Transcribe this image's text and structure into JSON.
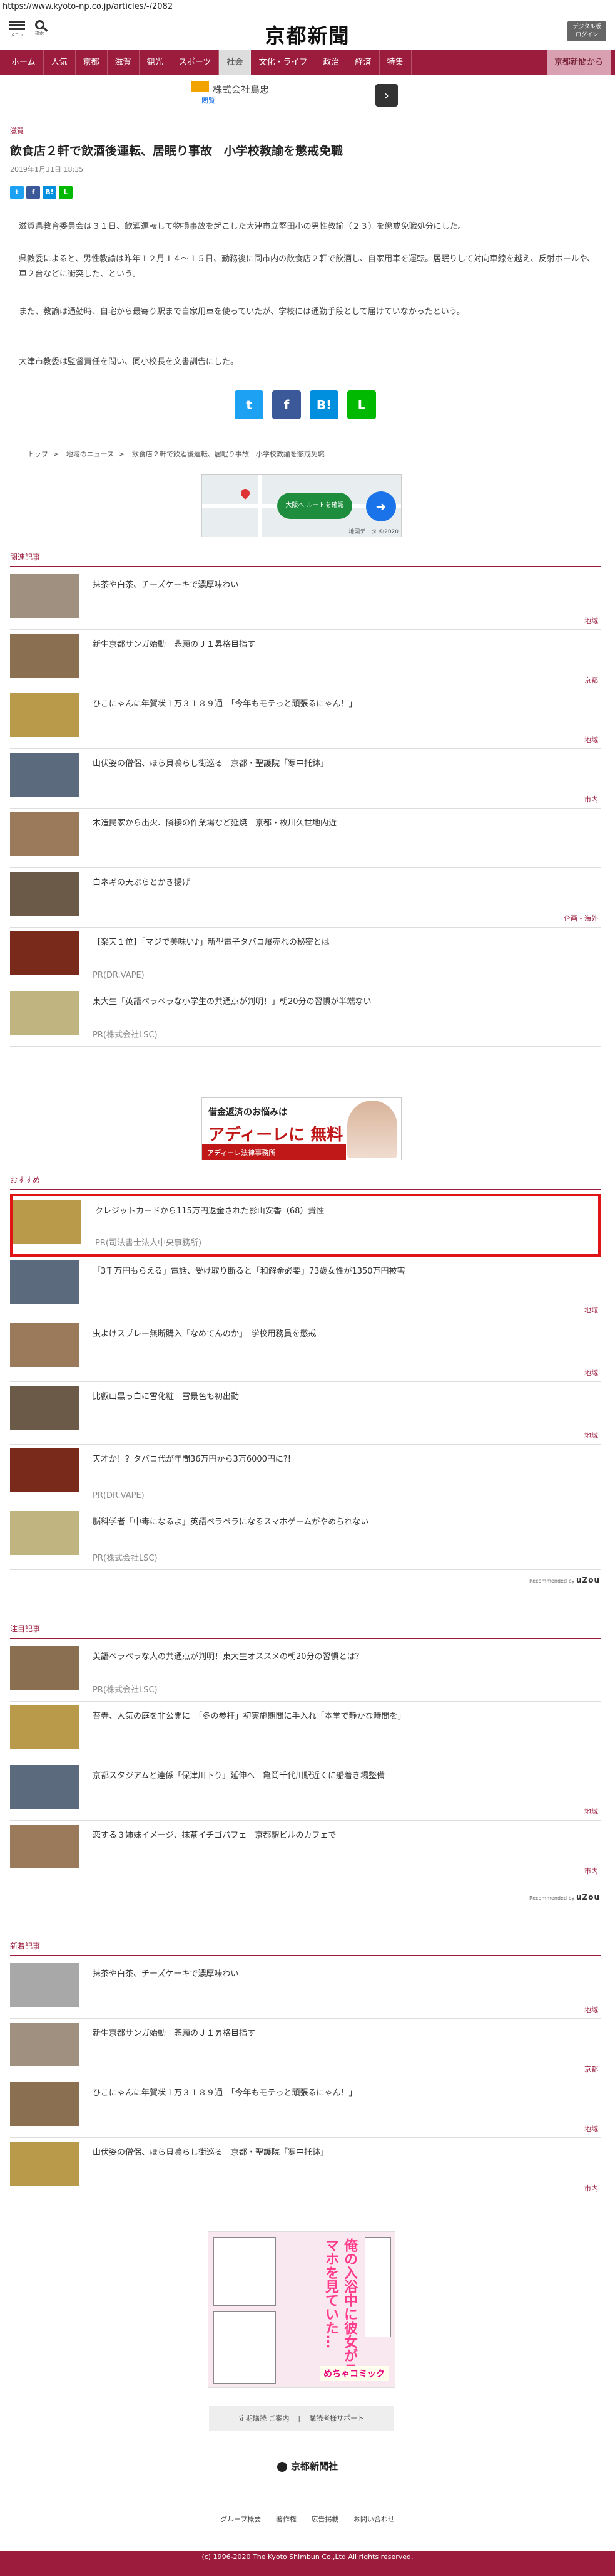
{
  "url": "https://www.kyoto-np.co.jp/articles/-/2082",
  "header": {
    "menu_label": "メニュー",
    "search_label": "検索",
    "logo": "京都新聞",
    "login": "デジタル版\nログイン"
  },
  "nav": [
    "ホーム",
    "人気",
    "京都",
    "滋賀",
    "観光",
    "スポーツ",
    "社会",
    "文化・ライフ",
    "政治",
    "経済",
    "特集",
    "京都新聞から"
  ],
  "nav_active": "社会",
  "ad_bar": {
    "name": "株式会社島忠",
    "link": "閲覧"
  },
  "article": {
    "category": "滋賀",
    "title": "飲食店２軒で飲酒後運転、居眠り事故　小学校教諭を懲戒免職",
    "date": "2019年1月31日 18:35",
    "paragraphs": [
      "滋賀県教育委員会は３１日、飲酒運転して物損事故を起こした大津市立堅田小の男性教諭（２３）を懲戒免職処分にした。",
      "県教委によると、男性教諭は昨年１２月１４～１５日、勤務後に同市内の飲食店２軒で飲酒し、自家用車を運転。居眠りして対向車線を越え、反射ポールや、車２台などに衝突した、という。",
      "また、教諭は通勤時、自宅から最寄り駅まで自家用車を使っていたが、学校には通勤手段として届けていなかったという。",
      "大津市教委は監督責任を問い、同小校長を文書訓告にした。"
    ]
  },
  "share": {
    "twitter": "t",
    "facebook": "f",
    "hatena": "B!",
    "line": "L"
  },
  "breadcrumb": [
    "トップ",
    "地域のニュース",
    "飲食店２軒で飲酒後運転、居眠り事故　小学校教諭を懲戒免職"
  ],
  "map": {
    "route": "大阪へ ルートを確認",
    "credit": "地図データ ©2020"
  },
  "related": {
    "heading": "関連記事",
    "items": [
      {
        "title": "抹茶や白茶、チーズケーキで濃厚味わい",
        "tag": "地域"
      },
      {
        "title": "新生京都サンガ始動　悲願のＪ１昇格目指す",
        "tag": "京都"
      },
      {
        "title": "ひこにゃんに年賀状１万３１８９通　「今年もモテっと頑張るにゃん！」",
        "tag": "地域"
      },
      {
        "title": "山伏姿の僧侶、ほら貝鳴らし街巡る　京都・聖護院「寒中托鉢」",
        "tag": "市内"
      },
      {
        "title": "木造民家から出火、隣接の作業場など延焼　京都・枚川久世地内近",
        "tag": ""
      },
      {
        "title": "白ネギの天ぷらとかき揚げ",
        "tag": "企画・海外"
      },
      {
        "title": "【楽天１位】「マジで美味い♪」新型電子タバコ爆売れの秘密とは",
        "pr": "PR(DR.VAPE)"
      },
      {
        "title": "東大生「英語ペラペラな小学生の共通点が判明！」朝20分の習慣が半端ない",
        "pr": "PR(株式会社LSC)"
      }
    ]
  },
  "ad_banner": {
    "line1": "借金返済のお悩みは",
    "line2": "アディーレに 無料 相談",
    "line3": "アディーレ法律事務所"
  },
  "recommend": {
    "heading": "おすすめ",
    "items": [
      {
        "title": "クレジットカードから115万円返金された影山安香（68）貴性",
        "pr": "PR(司法書士法人中央事務所)",
        "highlight": true
      },
      {
        "title": "「3千万円もらえる」電話、受け取り断ると「和解金必要」73歳女性が1350万円被害",
        "tag": "地域"
      },
      {
        "title": "虫よけスプレー無断購入「なめてんのか」　学校用務員を懲戒",
        "tag": "地域"
      },
      {
        "title": "比叡山黒っ白に雪化粧　雪景色も初出動",
        "tag": "地域"
      },
      {
        "title": "天才か！？タバコ代が年間36万円から3万6000円に?!",
        "pr": "PR(DR.VAPE)"
      },
      {
        "title": "脳科学者「中毒になるよ」英語ペラペラになるスマホゲームがやめられない",
        "pr": "PR(株式会社LSC)"
      }
    ],
    "credit": "Recommended by",
    "credit_brand": "uZou"
  },
  "featured": {
    "heading": "注目記事",
    "items": [
      {
        "title": "英語ペラペラな人の共通点が判明！東大生オススメの朝20分の習慣とは？",
        "pr": "PR(株式会社LSC)"
      },
      {
        "title": "苔寺、人気の庭を非公開に　「冬の参拝」初実施期間に手入れ「本堂で静かな時間を」",
        "tag": ""
      },
      {
        "title": "京都スタジアムと連係「保津川下り」延伸へ　亀岡千代川駅近くに船着き場整備",
        "tag": "地域"
      },
      {
        "title": "恋する３姉妹イメージ、抹茶イチゴパフェ　京都駅ビルのカフェで",
        "tag": "市内"
      }
    ],
    "credit": "Recommended by",
    "credit_brand": "uZou"
  },
  "latest": {
    "heading": "新着記事",
    "items": [
      {
        "title": "抹茶や白茶、チーズケーキで濃厚味わい",
        "tag": "地域"
      },
      {
        "title": "新生京都サンガ始動　悲願のＪ１昇格目指す",
        "tag": "京都"
      },
      {
        "title": "ひこにゃんに年賀状１万３１８９通　「今年もモテっと頑張るにゃん！」",
        "tag": "地域"
      },
      {
        "title": "山伏姿の僧侶、ほら貝鳴らし街巡る　京都・聖護院「寒中托鉢」",
        "tag": "市内"
      }
    ]
  },
  "manga_ad": {
    "text": "俺の入浴中に彼女がスマホを見ていた…",
    "brand": "めちゃコミック"
  },
  "footer": {
    "buttons": [
      "定期購読 ご案内",
      "購読者様サポート"
    ],
    "logo": "京都新聞社",
    "links": [
      "グループ概要",
      "著作権",
      "広告掲載",
      "お問い合わせ"
    ],
    "copyright": "(c) 1996-2020 The Kyoto Shimbun Co.,Ltd All rights reserved."
  }
}
